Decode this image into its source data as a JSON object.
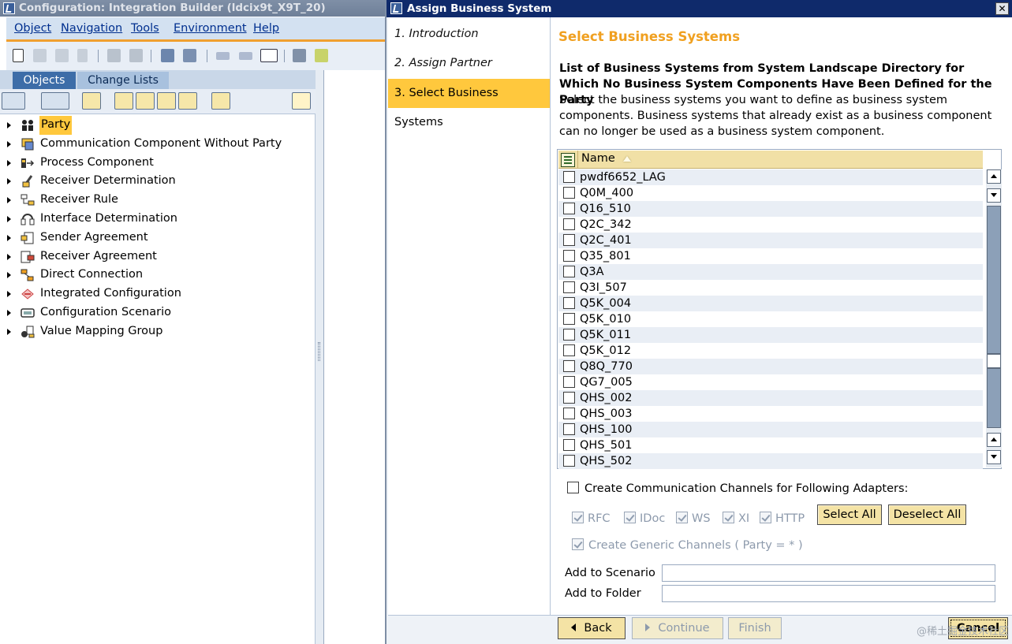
{
  "main_window": {
    "title": "Configuration: Integration Builder (ldcix9t_X9T_20)",
    "menu": [
      "Object",
      "Navigation",
      "Tools",
      "Environment",
      "Help"
    ],
    "tabs": {
      "objects": "Objects",
      "change_lists": "Change Lists"
    },
    "tree": [
      {
        "label": "Party",
        "icon": "party-icon",
        "selected": true
      },
      {
        "label": "Communication Component Without Party",
        "icon": "communication-component-icon"
      },
      {
        "label": "Process Component",
        "icon": "process-component-icon"
      },
      {
        "label": "Receiver Determination",
        "icon": "receiver-determination-icon"
      },
      {
        "label": "Receiver Rule",
        "icon": "receiver-rule-icon"
      },
      {
        "label": "Interface Determination",
        "icon": "interface-determination-icon"
      },
      {
        "label": "Sender Agreement",
        "icon": "sender-agreement-icon"
      },
      {
        "label": "Receiver Agreement",
        "icon": "receiver-agreement-icon"
      },
      {
        "label": "Direct Connection",
        "icon": "direct-connection-icon"
      },
      {
        "label": "Integrated Configuration",
        "icon": "integrated-configuration-icon"
      },
      {
        "label": "Configuration Scenario",
        "icon": "configuration-scenario-icon"
      },
      {
        "label": "Value Mapping Group",
        "icon": "value-mapping-group-icon"
      }
    ]
  },
  "dialog": {
    "title": "Assign Business System",
    "close_label": "✕",
    "steps": [
      {
        "label": "1. Introduction",
        "active": false
      },
      {
        "label": "2. Assign Partner",
        "active": false
      },
      {
        "label": "3. Select Business Systems",
        "active": true
      }
    ],
    "heading": "Select Business Systems",
    "list_title": "List of Business Systems from System Landscape Directory for Which No Business System Components Have Been Defined for the Party",
    "list_description": "Select the business systems you want to define as business system components. Business systems that already exist as a business component can no longer be used as a business system component.",
    "table": {
      "column_header": "Name",
      "rows": [
        "pwdf6652_LAG",
        "Q0M_400",
        "Q16_510",
        "Q2C_342",
        "Q2C_401",
        "Q35_801",
        "Q3A",
        "Q3I_507",
        "Q5K_004",
        "Q5K_010",
        "Q5K_011",
        "Q5K_012",
        "Q8Q_770",
        "QG7_005",
        "QHS_002",
        "QHS_003",
        "QHS_100",
        "QHS_501",
        "QHS_502"
      ]
    },
    "create_channels_label": "Create Communication Channels for Following Adapters:",
    "adapters": [
      "RFC",
      "IDoc",
      "WS",
      "XI",
      "HTTP"
    ],
    "select_all_label": "Select All",
    "deselect_all_label": "Deselect All",
    "generic_channels_label": "Create Generic Channels ( Party = * )",
    "add_to_scenario_label": "Add to Scenario",
    "add_to_folder_label": "Add to Folder",
    "footer": {
      "back_label": "Back",
      "continue_label": "Continue",
      "finish_label": "Finish",
      "cancel_label": "Cancel"
    },
    "watermark": "@稀土掘金技术社区"
  },
  "colors": {
    "selection": "#ffc83d",
    "heading_accent": "#f0a020",
    "dialog_titlebar": "#0f2a6b",
    "button_face": "#f4e3a5"
  }
}
